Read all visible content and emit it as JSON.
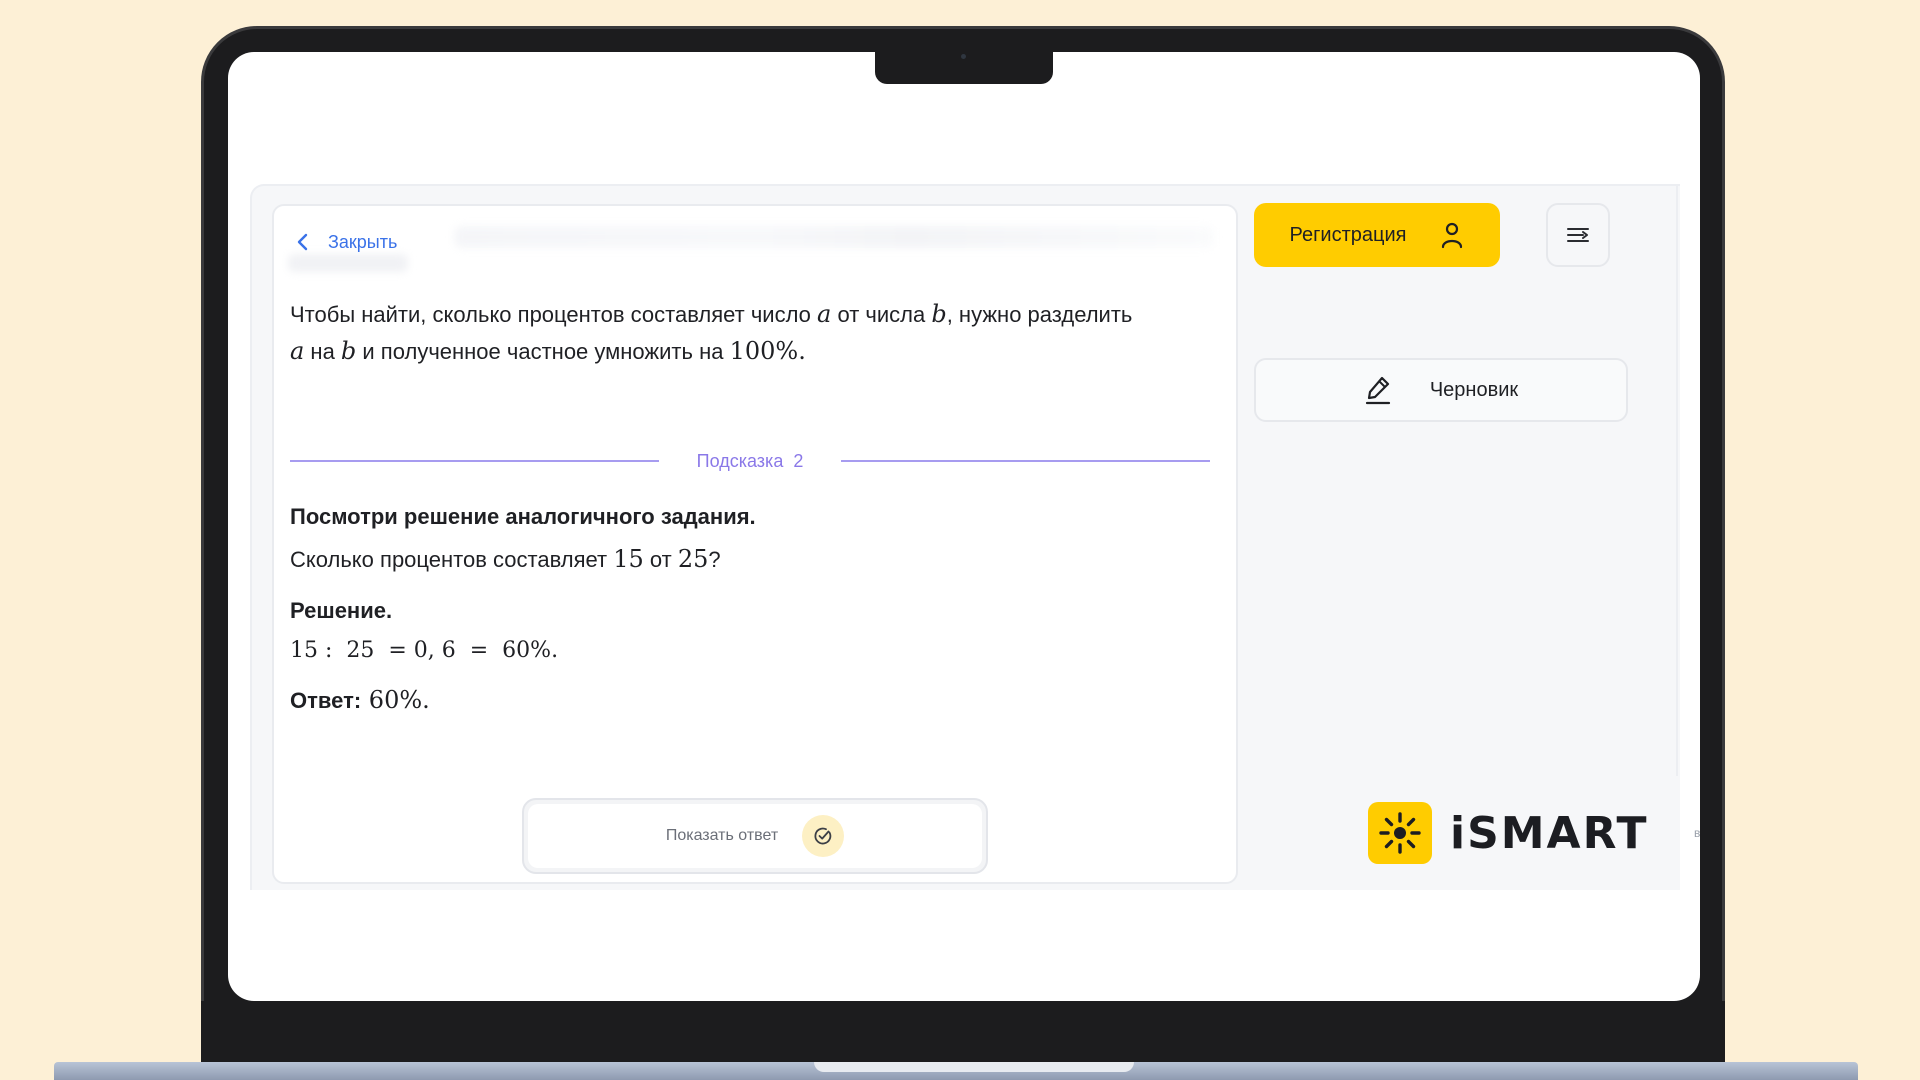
{
  "nav": {
    "back_label": "Закрыть"
  },
  "hint1": {
    "line1_a": "Чтобы найти, сколько процентов составляет число ",
    "var_a": "a",
    "line1_b": " от числа ",
    "var_b": "b",
    "line1_c": ", нужно разделить",
    "line2_var_a": "a",
    "line2_a": " на ",
    "line2_var_b": "b",
    "line2_b": " и полученное частное умножить на ",
    "line2_num": "100%."
  },
  "divider": {
    "label": "Подсказка  2"
  },
  "hint2": {
    "title": "Посмотри решение аналогичного задания.",
    "question_a": "Сколько процентов составляет ",
    "question_n1": "15",
    "question_b": " от ",
    "question_n2": "25",
    "question_c": "?",
    "solution_label": "Решение.",
    "solution_expr": "15 :  25  = 0, 6  =  60%.",
    "answer_label": "Ответ:",
    "answer_value": " 60%."
  },
  "show_answer_label": "Показать ответ",
  "sidebar": {
    "register_label": "Регистрация",
    "draft_label": "Черновик"
  },
  "logo": {
    "text": "iSMART"
  },
  "tiny_letter": "в",
  "colors": {
    "accent_yellow": "#ffcc00",
    "link_blue": "#3a72e8",
    "hint_purple": "#8a78e8",
    "background_cream": "#fdf0d6"
  },
  "icons": [
    "chevron-left-icon",
    "user-icon",
    "menu-icon",
    "pencil-icon",
    "check-circle-icon",
    "sun-logo-icon"
  ]
}
